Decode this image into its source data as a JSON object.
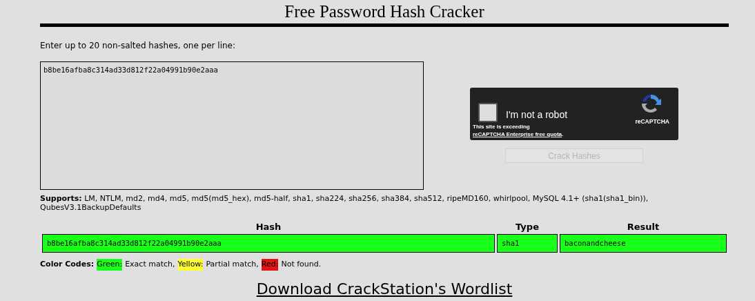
{
  "title": "Free Password Hash Cracker",
  "instructions": "Enter up to 20 non-salted hashes, one per line:",
  "hash_input": {
    "value": "b8be16afba8c314ad33d812f22a04991b90e2aaa"
  },
  "captcha": {
    "label": "I'm not a robot",
    "checked": false,
    "brand": "reCAPTCHA",
    "notice": "This site is exceeding ",
    "notice_link": "reCAPTCHA Enterprise free quota",
    "notice_end": "."
  },
  "crack_button": {
    "label": "Crack Hashes",
    "disabled": true
  },
  "supports": {
    "label": "Supports:",
    "text": "LM, NTLM, md2, md4, md5, md5(md5_hex), md5-half, sha1, sha224, sha256, sha384, sha512, ripeMD160, whirlpool, MySQL 4.1+ (sha1(sha1_bin)), QubesV3.1BackupDefaults"
  },
  "table": {
    "columns": [
      "Hash",
      "Type",
      "Result"
    ],
    "rows": [
      {
        "cells": [
          "b8be16afba8c314ad33d812f22a04991b90e2aaa",
          "sha1",
          "baconandcheese"
        ],
        "color": "#19ff19"
      }
    ]
  },
  "color_codes": {
    "label": "Color Codes:",
    "items": [
      {
        "name": "Green:",
        "color": "#19ff19",
        "meaning": "Exact match,"
      },
      {
        "name": "Yellow:",
        "color": "#ffff33",
        "meaning": "Partial match,"
      },
      {
        "name": "Red:",
        "color": "#e21414",
        "meaning": "Not found."
      }
    ]
  },
  "download_link": "Download CrackStation's Wordlist"
}
